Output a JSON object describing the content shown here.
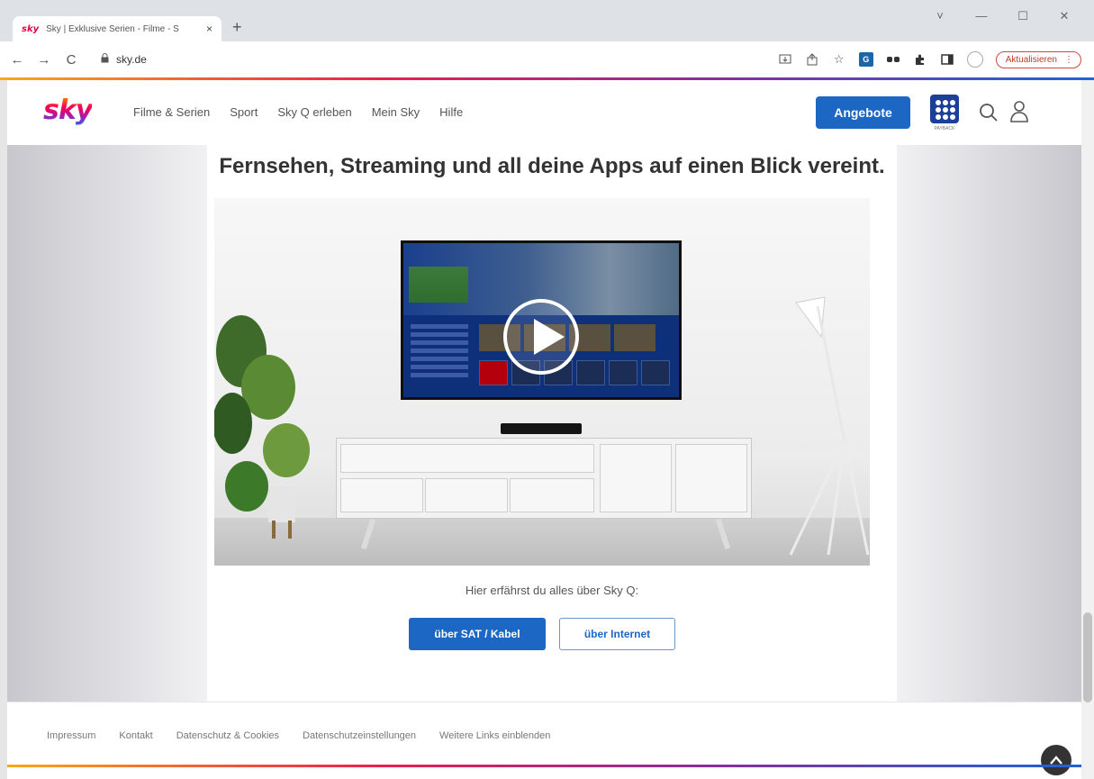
{
  "browser": {
    "tab_title": "Sky | Exklusive Serien - Filme - S",
    "tab_favicon": "sky",
    "tab_close": "×",
    "new_tab": "+",
    "window_controls": [
      "˅",
      "—",
      "☐",
      "✕"
    ],
    "url": "sky.de",
    "update_button": "Aktualisieren",
    "update_menu": "⋮",
    "nav": {
      "back": "←",
      "forward": "→",
      "reload": "C"
    }
  },
  "site": {
    "logo": "sky",
    "menu": [
      "Filme & Serien",
      "Sport",
      "Sky Q erleben",
      "Mein Sky",
      "Hilfe"
    ],
    "offers_button": "Angebote",
    "payback_label": "PAYBACK"
  },
  "main": {
    "headline": "Fernsehen, Streaming und all deine Apps auf einen Blick vereint.",
    "subtext": "Hier erfährst du alles über Sky Q:",
    "btn_sat": "über SAT / Kabel",
    "btn_internet": "über Internet"
  },
  "footer": {
    "links": [
      "Impressum",
      "Kontakt",
      "Datenschutz & Cookies",
      "Datenschutzeinstellungen",
      "Weitere Links einblenden"
    ]
  },
  "colors": {
    "accent": "#1c67c3",
    "brand_gradient": [
      "#f7a81b",
      "#e9204f",
      "#8a2e9b",
      "#1e64d6"
    ],
    "update_red": "#c0392b"
  }
}
